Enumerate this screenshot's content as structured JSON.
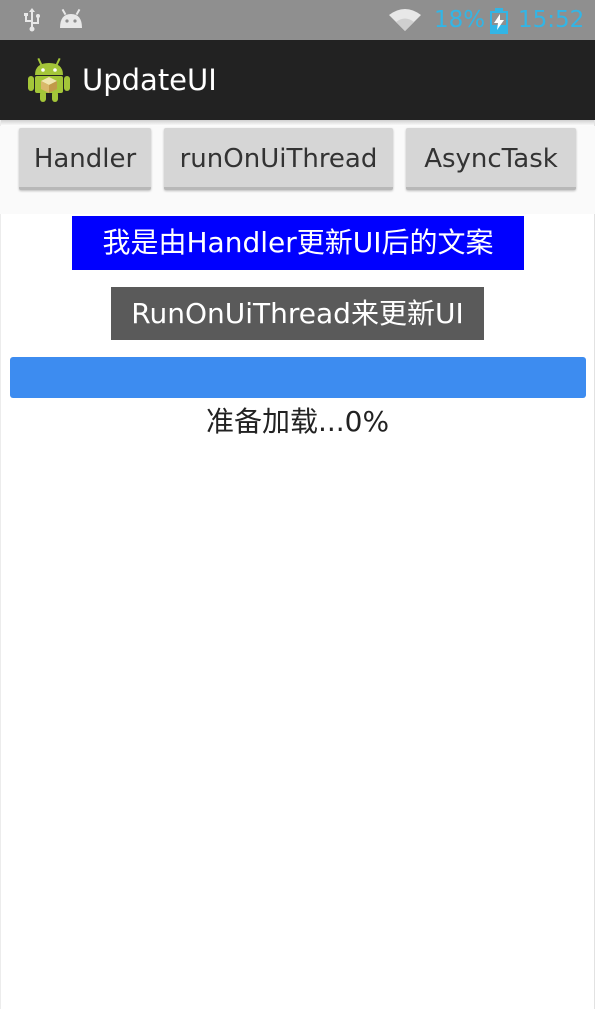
{
  "status_bar": {
    "icons": [
      "usb-icon",
      "android-debug-icon",
      "wifi-icon",
      "battery-charging-icon"
    ],
    "battery_percent": "18%",
    "time": "15:52",
    "accent_color": "#33b5e5"
  },
  "action_bar": {
    "app_icon": "android-robot-icon",
    "title": "UpdateUI"
  },
  "buttons": {
    "handler_label": "Handler",
    "runonui_label": "runOnUiThread",
    "async_label": "AsyncTask"
  },
  "labels": {
    "handler_text": "我是由Handler更新UI后的文案",
    "handler_bg": "#0000ff",
    "runonui_text": "RunOnUiThread来更新UI",
    "runonui_bg": "#5a5a5a"
  },
  "progress": {
    "value_percent": 0,
    "bar_color": "#3d8cf0",
    "text": "准备加载...0%"
  }
}
